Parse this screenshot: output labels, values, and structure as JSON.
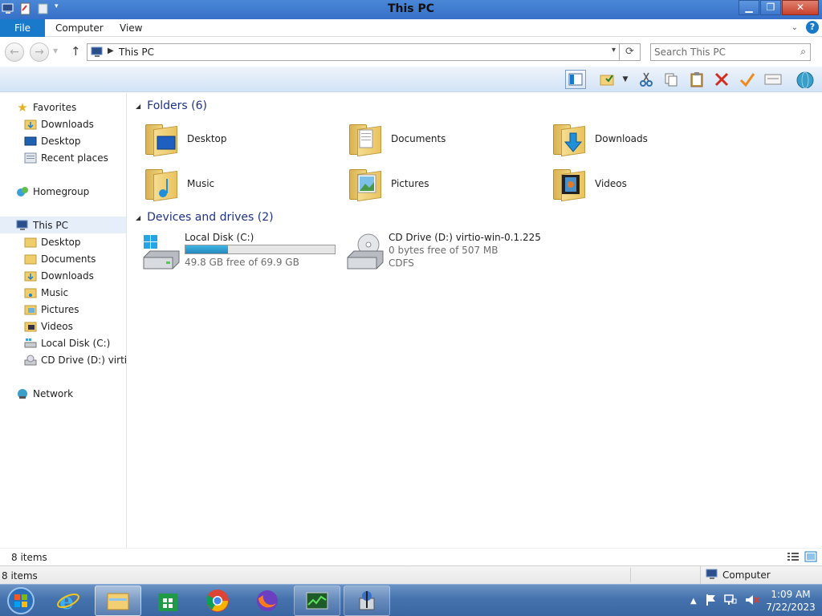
{
  "window": {
    "title": "This PC"
  },
  "ribbon": {
    "tabs": [
      {
        "label": "File"
      },
      {
        "label": "Computer"
      },
      {
        "label": "View"
      }
    ]
  },
  "address": {
    "path": "This PC",
    "search_placeholder": "Search This PC"
  },
  "nav": {
    "favorites": "Favorites",
    "favorites_items": [
      "Downloads",
      "Desktop",
      "Recent places"
    ],
    "homegroup": "Homegroup",
    "this_pc": "This PC",
    "this_pc_items": [
      "Desktop",
      "Documents",
      "Downloads",
      "Music",
      "Pictures",
      "Videos",
      "Local Disk (C:)",
      "CD Drive (D:) virtio-win-0.1.225"
    ],
    "network": "Network"
  },
  "content": {
    "folders_header": "Folders (6)",
    "folders": [
      {
        "name": "Desktop",
        "icon": "desktop-folder-icon"
      },
      {
        "name": "Documents",
        "icon": "documents-folder-icon"
      },
      {
        "name": "Downloads",
        "icon": "downloads-folder-icon"
      },
      {
        "name": "Music",
        "icon": "music-folder-icon"
      },
      {
        "name": "Pictures",
        "icon": "pictures-folder-icon"
      },
      {
        "name": "Videos",
        "icon": "videos-folder-icon"
      }
    ],
    "drives_header": "Devices and drives (2)",
    "drives": [
      {
        "name": "Local Disk (C:)",
        "free": "49.8 GB free of 69.9 GB",
        "used_fraction": 0.2876
      },
      {
        "name": "CD Drive (D:) virtio-win-0.1.225",
        "free": "0 bytes free of 507 MB",
        "fs": "CDFS"
      }
    ]
  },
  "status": {
    "item_count": "8 items",
    "item_count2": "8 items",
    "zone": "Computer"
  },
  "taskbar": {
    "time": "1:09 AM",
    "date": "7/22/2023"
  },
  "colors": {
    "accent": "#1979ca",
    "title_bar": "#3670c8",
    "header_text": "#1e3287",
    "taskbar": "#4572ad"
  }
}
